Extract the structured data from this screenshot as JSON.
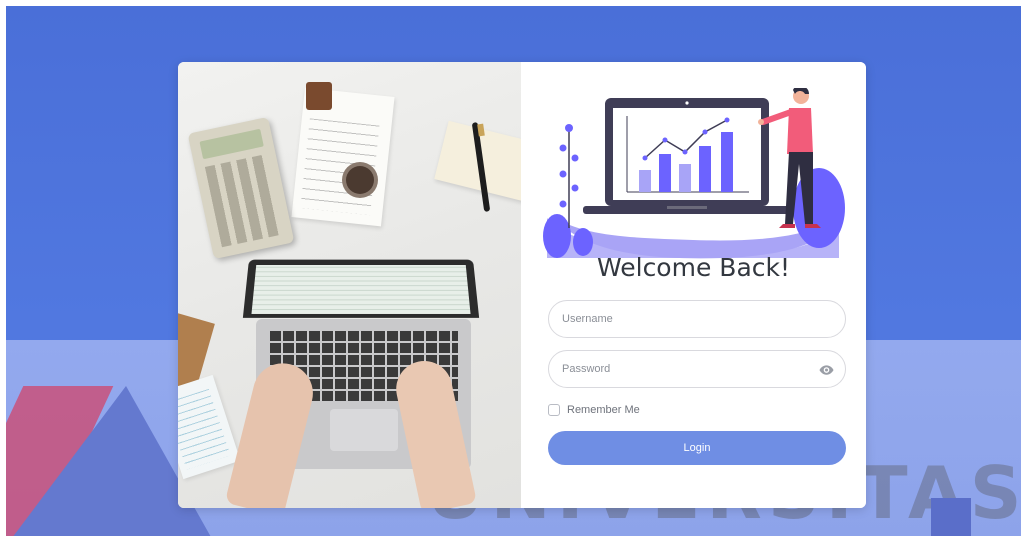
{
  "login": {
    "welcome_title": "Welcome Back!",
    "username_placeholder": "Username",
    "password_placeholder": "Password",
    "remember_label": "Remember Me",
    "remember_checked": false,
    "login_label": "Login"
  },
  "watermark": {
    "text": "UNIVERSITAS"
  },
  "colors": {
    "background": "#4a6fd8",
    "accent": "#6f8ee4",
    "illustration_primary": "#6c63ff",
    "illustration_secondary": "#a8a4f7"
  },
  "icons": {
    "password_toggle": "eye-icon"
  }
}
